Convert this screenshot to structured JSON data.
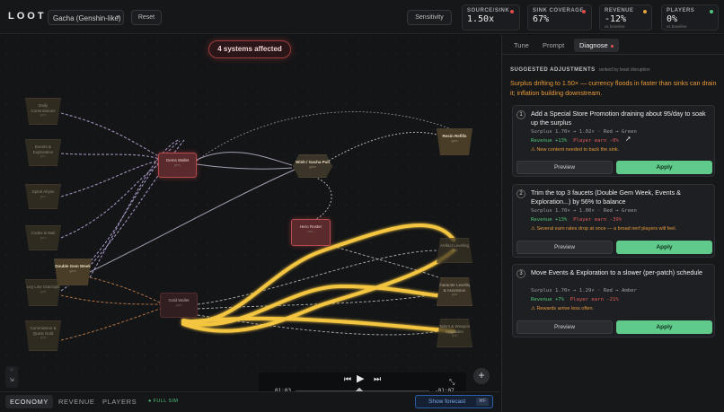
{
  "app": {
    "logo": "LOOT"
  },
  "header": {
    "preset": "Gacha (Genshin-like)",
    "reset": "Reset",
    "sensitivity": "Sensitivity",
    "metrics": [
      {
        "label": "SOURCE/SINK",
        "value": "1.50x",
        "sub": "",
        "dot": "#e04a4a"
      },
      {
        "label": "SINK COVERAGE",
        "value": "67%",
        "sub": "",
        "dot": "#e04a4a"
      },
      {
        "label": "REVENUE",
        "value": "-12%",
        "sub": "vs baseline",
        "dot": "#e8a23a"
      },
      {
        "label": "PLAYERS",
        "value": "0%",
        "sub": "vs baseline",
        "dot": "#4fc57a"
      }
    ]
  },
  "canvas": {
    "affected": "4 systems affected",
    "nodes": {
      "daily": {
        "label": "Daily Commissions",
        "sub": "gem"
      },
      "events": {
        "label": "Events & Exploration",
        "sub": "gem"
      },
      "spiral": {
        "label": "Spiral Abyss",
        "sub": "gem"
      },
      "codes": {
        "label": "Codes & Mail",
        "sub": "gem"
      },
      "ley": {
        "label": "Ley Line Outcrops",
        "sub": "gold"
      },
      "commission_gold": {
        "label": "Commission & Quest Gold",
        "sub": "gold"
      },
      "double_gem": {
        "label": "Double Gem Week",
        "sub": "gem"
      },
      "gems_wallet": {
        "label": "Gems Wallet",
        "sub": "gem"
      },
      "wish": {
        "label": "Wish / Gacha Pull",
        "sub": "gem"
      },
      "hero_roster": {
        "label": "Hero Roster",
        "sub": "hero"
      },
      "gold_wallet": {
        "label": "Gold Wallet",
        "sub": "gold"
      },
      "resin": {
        "label": "Resin Refills",
        "sub": "gem"
      },
      "artifact": {
        "label": "Artifact Leveling",
        "sub": "gold"
      },
      "character": {
        "label": "Character Leveling & Ascension",
        "sub": "gold"
      },
      "talent": {
        "label": "Talent & Weapon Upgrades",
        "sub": "gold"
      }
    }
  },
  "player": {
    "current": "01:03",
    "remaining": "-01:07"
  },
  "bottom": {
    "tabs": [
      "ECONOMY",
      "REVENUE",
      "PLAYERS"
    ],
    "fullsim": "FULL SIM",
    "forecast": "Show forecast",
    "forecast_key": "⌘F"
  },
  "panel": {
    "tabs": [
      "Tune",
      "Prompt",
      "Diagnose"
    ],
    "heading": "SUGGESTED ADJUSTMENTS",
    "heading_sub": "ranked by least disruption",
    "warning": "Surplus drifting to 1.50× — currency floods in faster than sinks can drain it; inflation building downstream.",
    "cards": [
      {
        "num": "1",
        "title": "Add a Special Store Promotion draining about 95/day to soak up the surplus",
        "surplus": "Surplus 1.70× → 1.02× · Red → Green",
        "revenue": "Revenue +13%",
        "player": "Player earn -0%",
        "note": "⚠ New content needed to back the sink.",
        "preview": "Preview",
        "apply": "Apply"
      },
      {
        "num": "2",
        "title": "Trim the top 3 faucets (Double Gem Week, Events & Exploration...) by 56% to balance",
        "surplus": "Surplus 1.70× → 1.00× · Red → Green",
        "revenue": "Revenue +13%",
        "player": "Player earn -39%",
        "note": "⚠ Several earn rates drop at once — a broad nerf players will feel.",
        "preview": "Preview",
        "apply": "Apply"
      },
      {
        "num": "3",
        "title": "Move Events & Exploration to a slower (per-patch) schedule",
        "surplus": "Surplus 1.70× → 1.29× · Red → Amber",
        "revenue": "Revenue +7%",
        "player": "Player earn -21%",
        "note": "⚠ Rewards arrive less often.",
        "preview": "Preview",
        "apply": "Apply"
      }
    ]
  }
}
